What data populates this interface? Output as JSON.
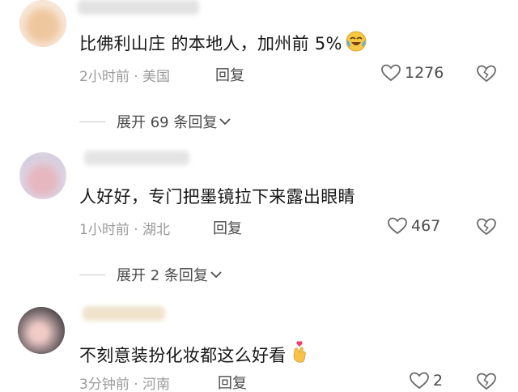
{
  "comments": [
    {
      "text": "比佛利山庄 的本地人，加州前 5%",
      "time": "2小时前",
      "location": "美国",
      "reply_label": "回复",
      "likes": "1276",
      "expand_label": "展开 69 条回复"
    },
    {
      "text": "人好好，专门把墨镜拉下来露出眼睛",
      "time": "1小时前",
      "location": "湖北",
      "reply_label": "回复",
      "likes": "467",
      "expand_label": "展开 2 条回复"
    },
    {
      "text": "不刻意装扮化妆都这么好看",
      "time": "3分钟前",
      "location": "河南",
      "reply_label": "回复",
      "likes": "2"
    }
  ],
  "meta_separator": "·",
  "icons": {
    "like": "heart-outline-icon",
    "dislike": "broken-heart-icon",
    "expand": "chevron-down-icon",
    "emoji_1": "crying-laughing-emoji",
    "emoji_3": "finger-heart-emoji"
  },
  "colors": {
    "text": "#161616",
    "meta": "#9a9a9a",
    "action": "#4a4a4a"
  }
}
